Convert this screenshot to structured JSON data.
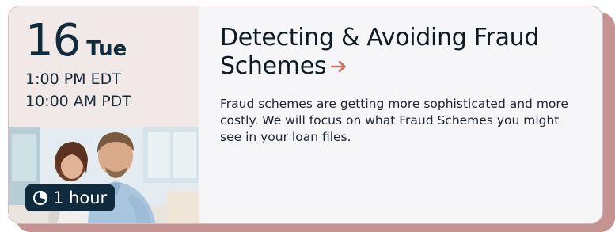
{
  "event": {
    "day_number": "16",
    "weekday": "Tue",
    "time_edt": "1:00 PM EDT",
    "time_pdt": "10:00 AM PDT",
    "duration": "1 hour",
    "title_line1": "Detecting & Avoiding Fraud",
    "title_line2": "Schemes",
    "description": "Fraud schemes are getting more sophisticated and more costly. We will focus on what Fraud Schemes you might see in your loan files."
  },
  "icons": {
    "arrow": "arrow-right-icon",
    "clock": "clock-icon"
  },
  "colors": {
    "navy": "#0f2b3d",
    "accent": "#c47563",
    "shadow": "#c49392",
    "left_panel": "#f1e9e7",
    "card_bg": "#f6f6f8"
  }
}
